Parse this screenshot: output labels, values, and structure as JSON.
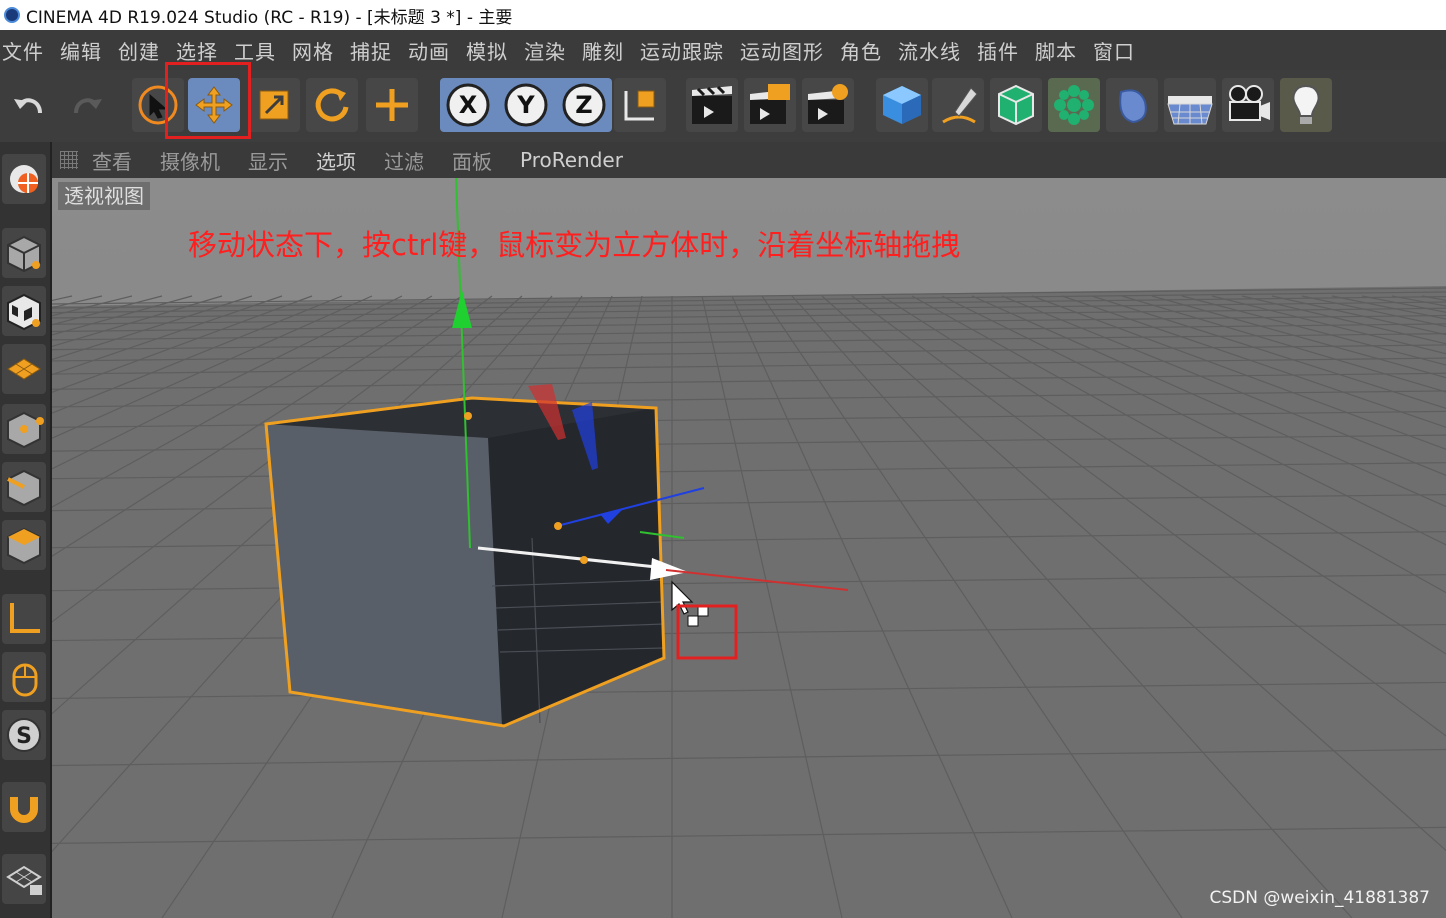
{
  "window": {
    "title": "CINEMA 4D R19.024 Studio (RC - R19) - [未标题 3 *] - 主要"
  },
  "menu": [
    "文件",
    "编辑",
    "创建",
    "选择",
    "工具",
    "网格",
    "捕捉",
    "动画",
    "模拟",
    "渲染",
    "雕刻",
    "运动跟踪",
    "运动图形",
    "角色",
    "流水线",
    "插件",
    "脚本",
    "窗口"
  ],
  "toolbar": {
    "buttons": [
      {
        "name": "undo-icon"
      },
      {
        "name": "redo-icon"
      },
      {
        "name": "live-select-icon"
      },
      {
        "name": "move-icon"
      },
      {
        "name": "scale-icon"
      },
      {
        "name": "rotate-icon"
      },
      {
        "name": "recent-tool-icon"
      },
      {
        "name": "x-axis-icon",
        "label": "X"
      },
      {
        "name": "y-axis-icon",
        "label": "Y"
      },
      {
        "name": "z-axis-icon",
        "label": "Z"
      },
      {
        "name": "coordinate-system-icon"
      },
      {
        "name": "render-view-icon"
      },
      {
        "name": "render-picture-viewer-icon"
      },
      {
        "name": "render-settings-icon"
      },
      {
        "name": "cube-icon"
      },
      {
        "name": "pen-icon"
      },
      {
        "name": "subdivision-icon"
      },
      {
        "name": "cloner-icon"
      },
      {
        "name": "deformer-icon"
      },
      {
        "name": "floor-icon"
      },
      {
        "name": "camera-icon"
      },
      {
        "name": "light-icon"
      }
    ]
  },
  "view_menu": [
    "查看",
    "摄像机",
    "显示",
    "选项",
    "过滤",
    "面板",
    "ProRender"
  ],
  "viewport": {
    "label": "透视视图"
  },
  "annotation": {
    "text": "移动状态下，按ctrl键，鼠标变为立方体时，沿着坐标轴拖拽"
  },
  "watermark": "CSDN @weixin_41881387",
  "colors": {
    "highlight": "#e32020",
    "accent_orange": "#f0a020",
    "axis_x": "#e03030",
    "axis_y": "#20c030",
    "axis_z": "#2040e0"
  }
}
